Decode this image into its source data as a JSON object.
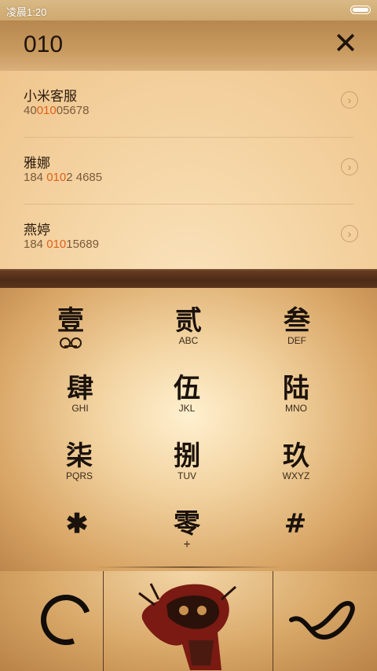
{
  "status": {
    "time": "凌晨1:20"
  },
  "header": {
    "query": "010",
    "close_label": "✕"
  },
  "results": [
    {
      "name": "小米客服",
      "num_pre": "40",
      "num_hl": "010",
      "num_post": "05678"
    },
    {
      "name": "雅娜",
      "num_pre": "184 ",
      "num_hl": "010",
      "num_post": "2 4685"
    },
    {
      "name": "燕婷",
      "num_pre": "184 ",
      "num_hl": "010",
      "num_post": "15689"
    }
  ],
  "keys": [
    {
      "glyph": "壹",
      "letters": ""
    },
    {
      "glyph": "贰",
      "letters": "ABC"
    },
    {
      "glyph": "叁",
      "letters": "DEF"
    },
    {
      "glyph": "肆",
      "letters": "GHI"
    },
    {
      "glyph": "伍",
      "letters": "JKL"
    },
    {
      "glyph": "陆",
      "letters": "MNO"
    },
    {
      "glyph": "柒",
      "letters": "PQRS"
    },
    {
      "glyph": "捌",
      "letters": "TUV"
    },
    {
      "glyph": "玖",
      "letters": "WXYZ"
    },
    {
      "glyph": "✱",
      "letters": ""
    },
    {
      "glyph": "零",
      "letters": "+"
    },
    {
      "glyph": "#",
      "letters": ""
    }
  ],
  "icons": {
    "voicemail": "voicemail-icon",
    "delete": "ink-circle-delete-icon",
    "call": "ink-call-icon",
    "center": "peking-opera-puppet-icon"
  },
  "colors": {
    "highlight": "#e0601a",
    "ink": "#1b120b"
  }
}
